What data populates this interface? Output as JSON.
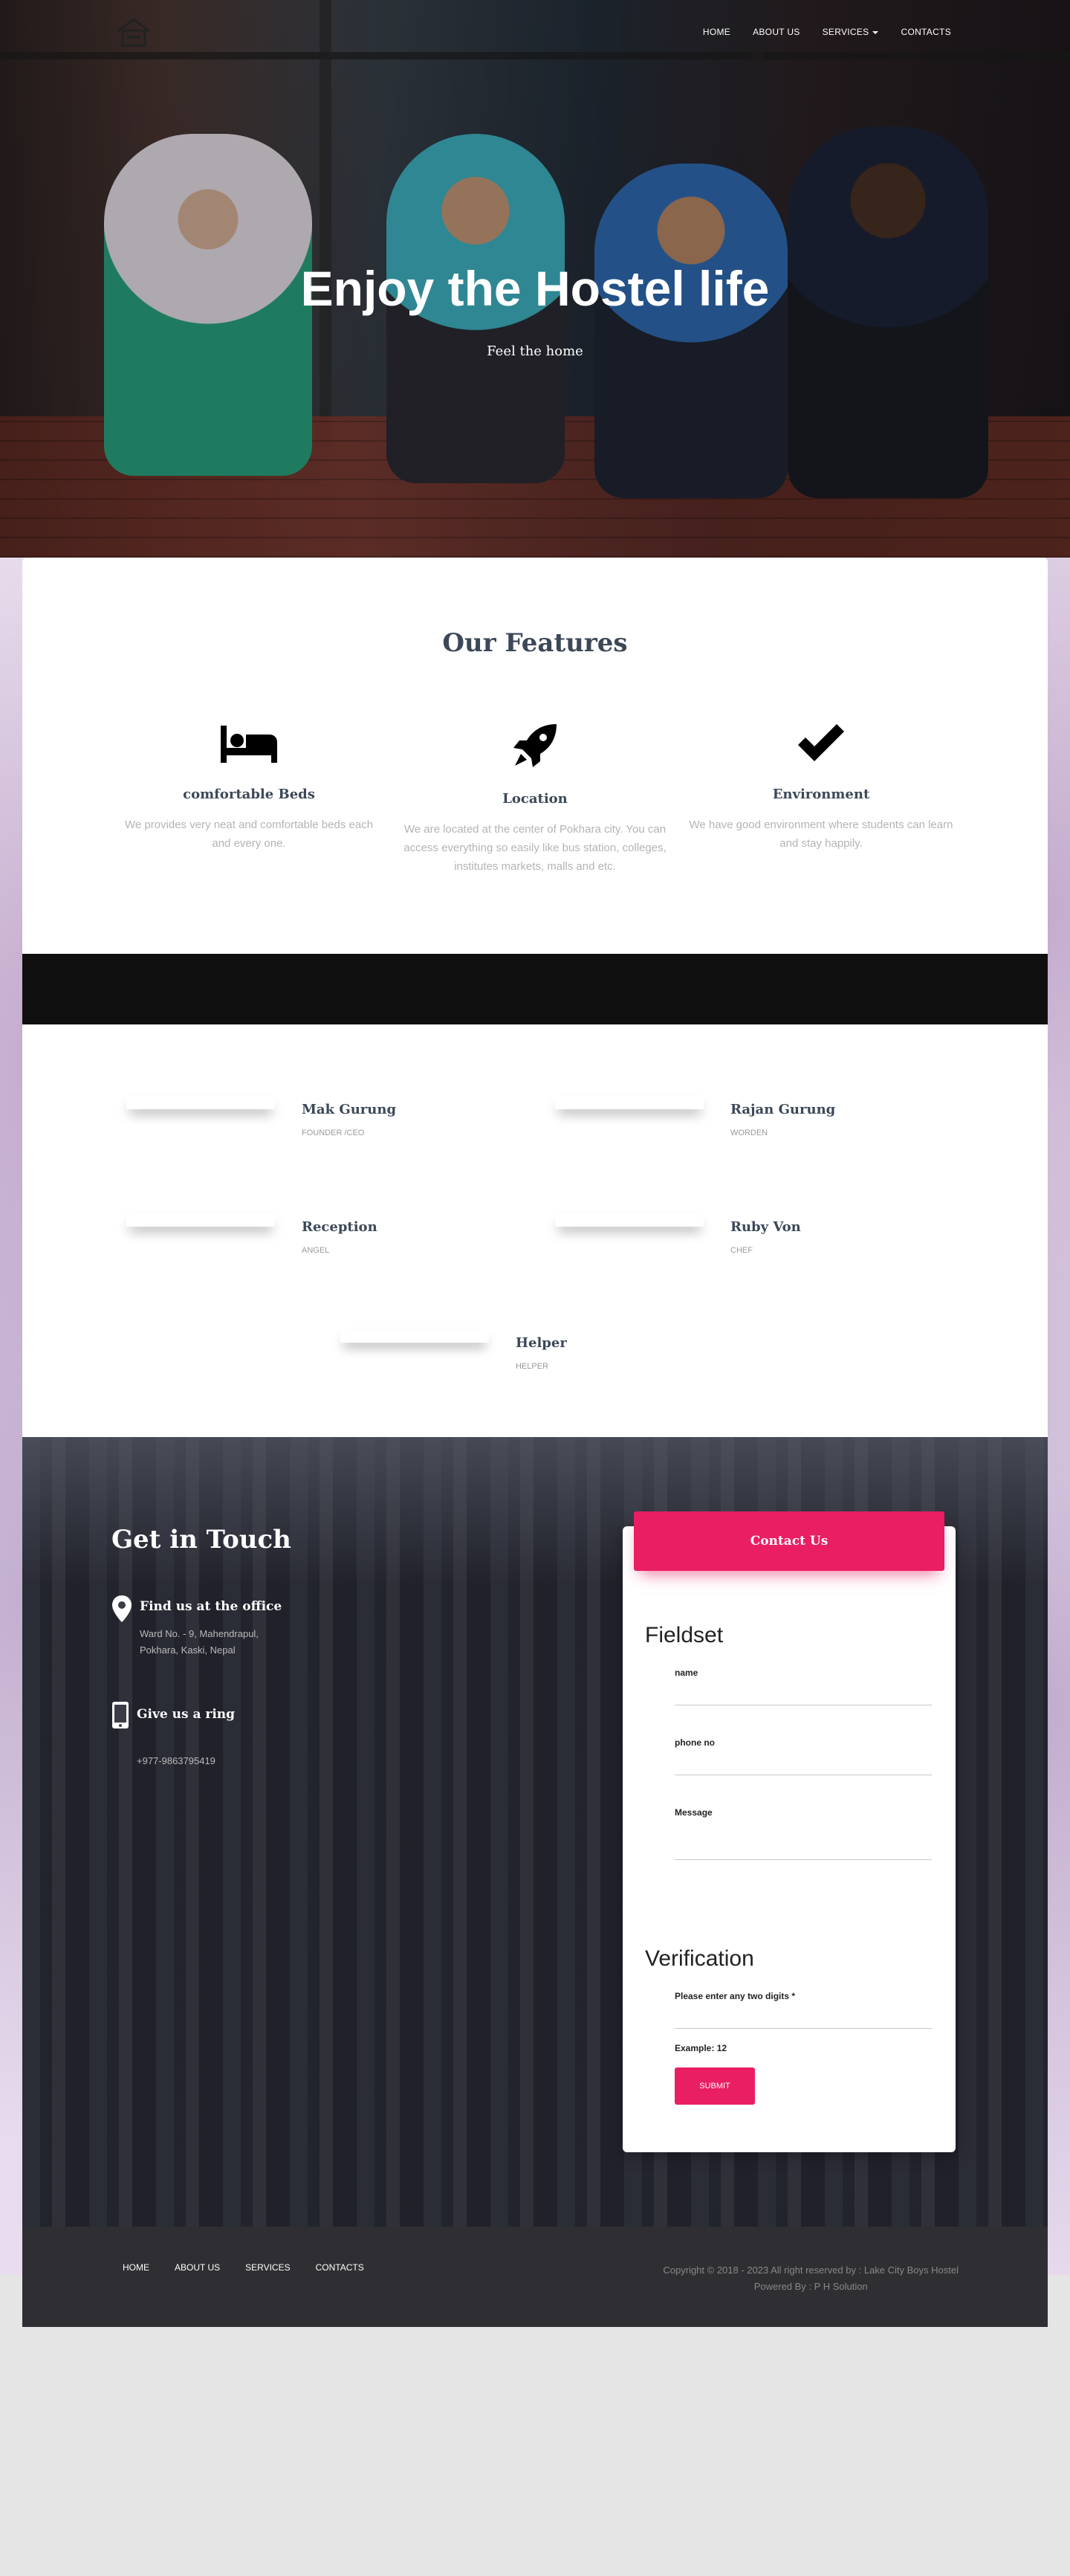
{
  "nav": {
    "items": [
      {
        "label": "HOME"
      },
      {
        "label": "ABOUT US"
      },
      {
        "label": "SERVICES"
      },
      {
        "label": "CONTACTS"
      }
    ]
  },
  "hero": {
    "title": "Enjoy the Hostel life",
    "subtitle": "Feel the home"
  },
  "features": {
    "title": "Our Features",
    "items": [
      {
        "icon": "bed-icon",
        "title": "comfortable Beds",
        "text": "We provides very neat and comfortable beds each and every one."
      },
      {
        "icon": "rocket-icon",
        "title": "Location",
        "text": "We are located at the center of Pokhara city. You can access everything so easily like bus station, colleges, institutes markets, malls and etc."
      },
      {
        "icon": "check-icon",
        "title": "Environment",
        "text": "We have good environment where students can learn and stay happily."
      }
    ]
  },
  "team": [
    {
      "name": "Mak Gurung",
      "role": "FOUNDER /CEO"
    },
    {
      "name": "Rajan Gurung",
      "role": "WORDEN"
    },
    {
      "name": "Reception",
      "role": "ANGEL"
    },
    {
      "name": "Ruby Von",
      "role": "CHEF"
    },
    {
      "name": "Helper",
      "role": "HELPER"
    }
  ],
  "contact": {
    "title": "Get in Touch",
    "office_title": "Find us at the office",
    "office_address": "Ward No. - 9, Mahendrapul, Pokhara, Kaski, Nepal",
    "ring_title": "Give us a ring",
    "phone": "+977-9863795419",
    "form": {
      "header": "Contact Us",
      "legend1": "Fieldset",
      "name_label": "name",
      "phone_label": "phone no",
      "message_label": "Message",
      "legend2": "Verification",
      "verify_label": "Please enter any two digits *",
      "example": "Example: 12",
      "submit": "SUBMIT"
    }
  },
  "footer": {
    "links": [
      {
        "label": "HOME"
      },
      {
        "label": "ABOUT US"
      },
      {
        "label": "SERVICES"
      },
      {
        "label": "CONTACTS"
      }
    ],
    "copyright": "Copyright © 2018 - 2023 All right reserved by : Lake City Boys Hostel",
    "powered": "Powered By : P H Solution"
  },
  "colors": {
    "accent": "#e91e63",
    "heading": "#3c4858",
    "footer_bg": "#2f2f33"
  }
}
